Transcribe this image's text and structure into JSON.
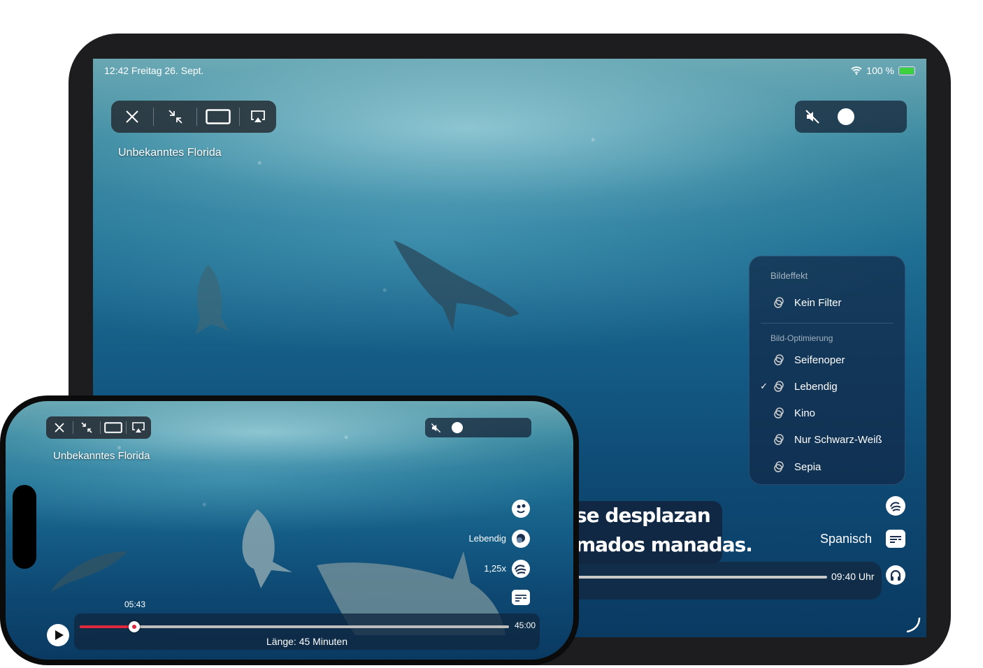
{
  "ipad": {
    "status": {
      "time_date": "12:42  Freitag 26. Sept.",
      "battery": "100 %"
    },
    "title": "Unbekanntes Florida",
    "picture_menu": {
      "header_effect": "Bildeffekt",
      "effect_item": "Kein Filter",
      "header_optimize": "Bild-Optimierung",
      "items": [
        {
          "label": "Seifenoper",
          "checked": false
        },
        {
          "label": "Lebendig",
          "checked": true
        },
        {
          "label": "Kino",
          "checked": false
        },
        {
          "label": "Nur Schwarz-Weiß",
          "checked": false
        },
        {
          "label": "Sepia",
          "checked": false
        }
      ],
      "check_mark": "✓"
    },
    "subtitle": {
      "line1": "se desplazan",
      "line2": "mados manadas."
    },
    "end_time": "09:40 Uhr",
    "subtitle_language": "Spanisch"
  },
  "iphone": {
    "title": "Unbekanntes Florida",
    "picture_mode": "Lebendig",
    "speed": "1,25x",
    "current_time": "05:43",
    "duration": "45:00",
    "length_label": "Länge: 45 Minuten",
    "progress_fraction": 0.127
  }
}
